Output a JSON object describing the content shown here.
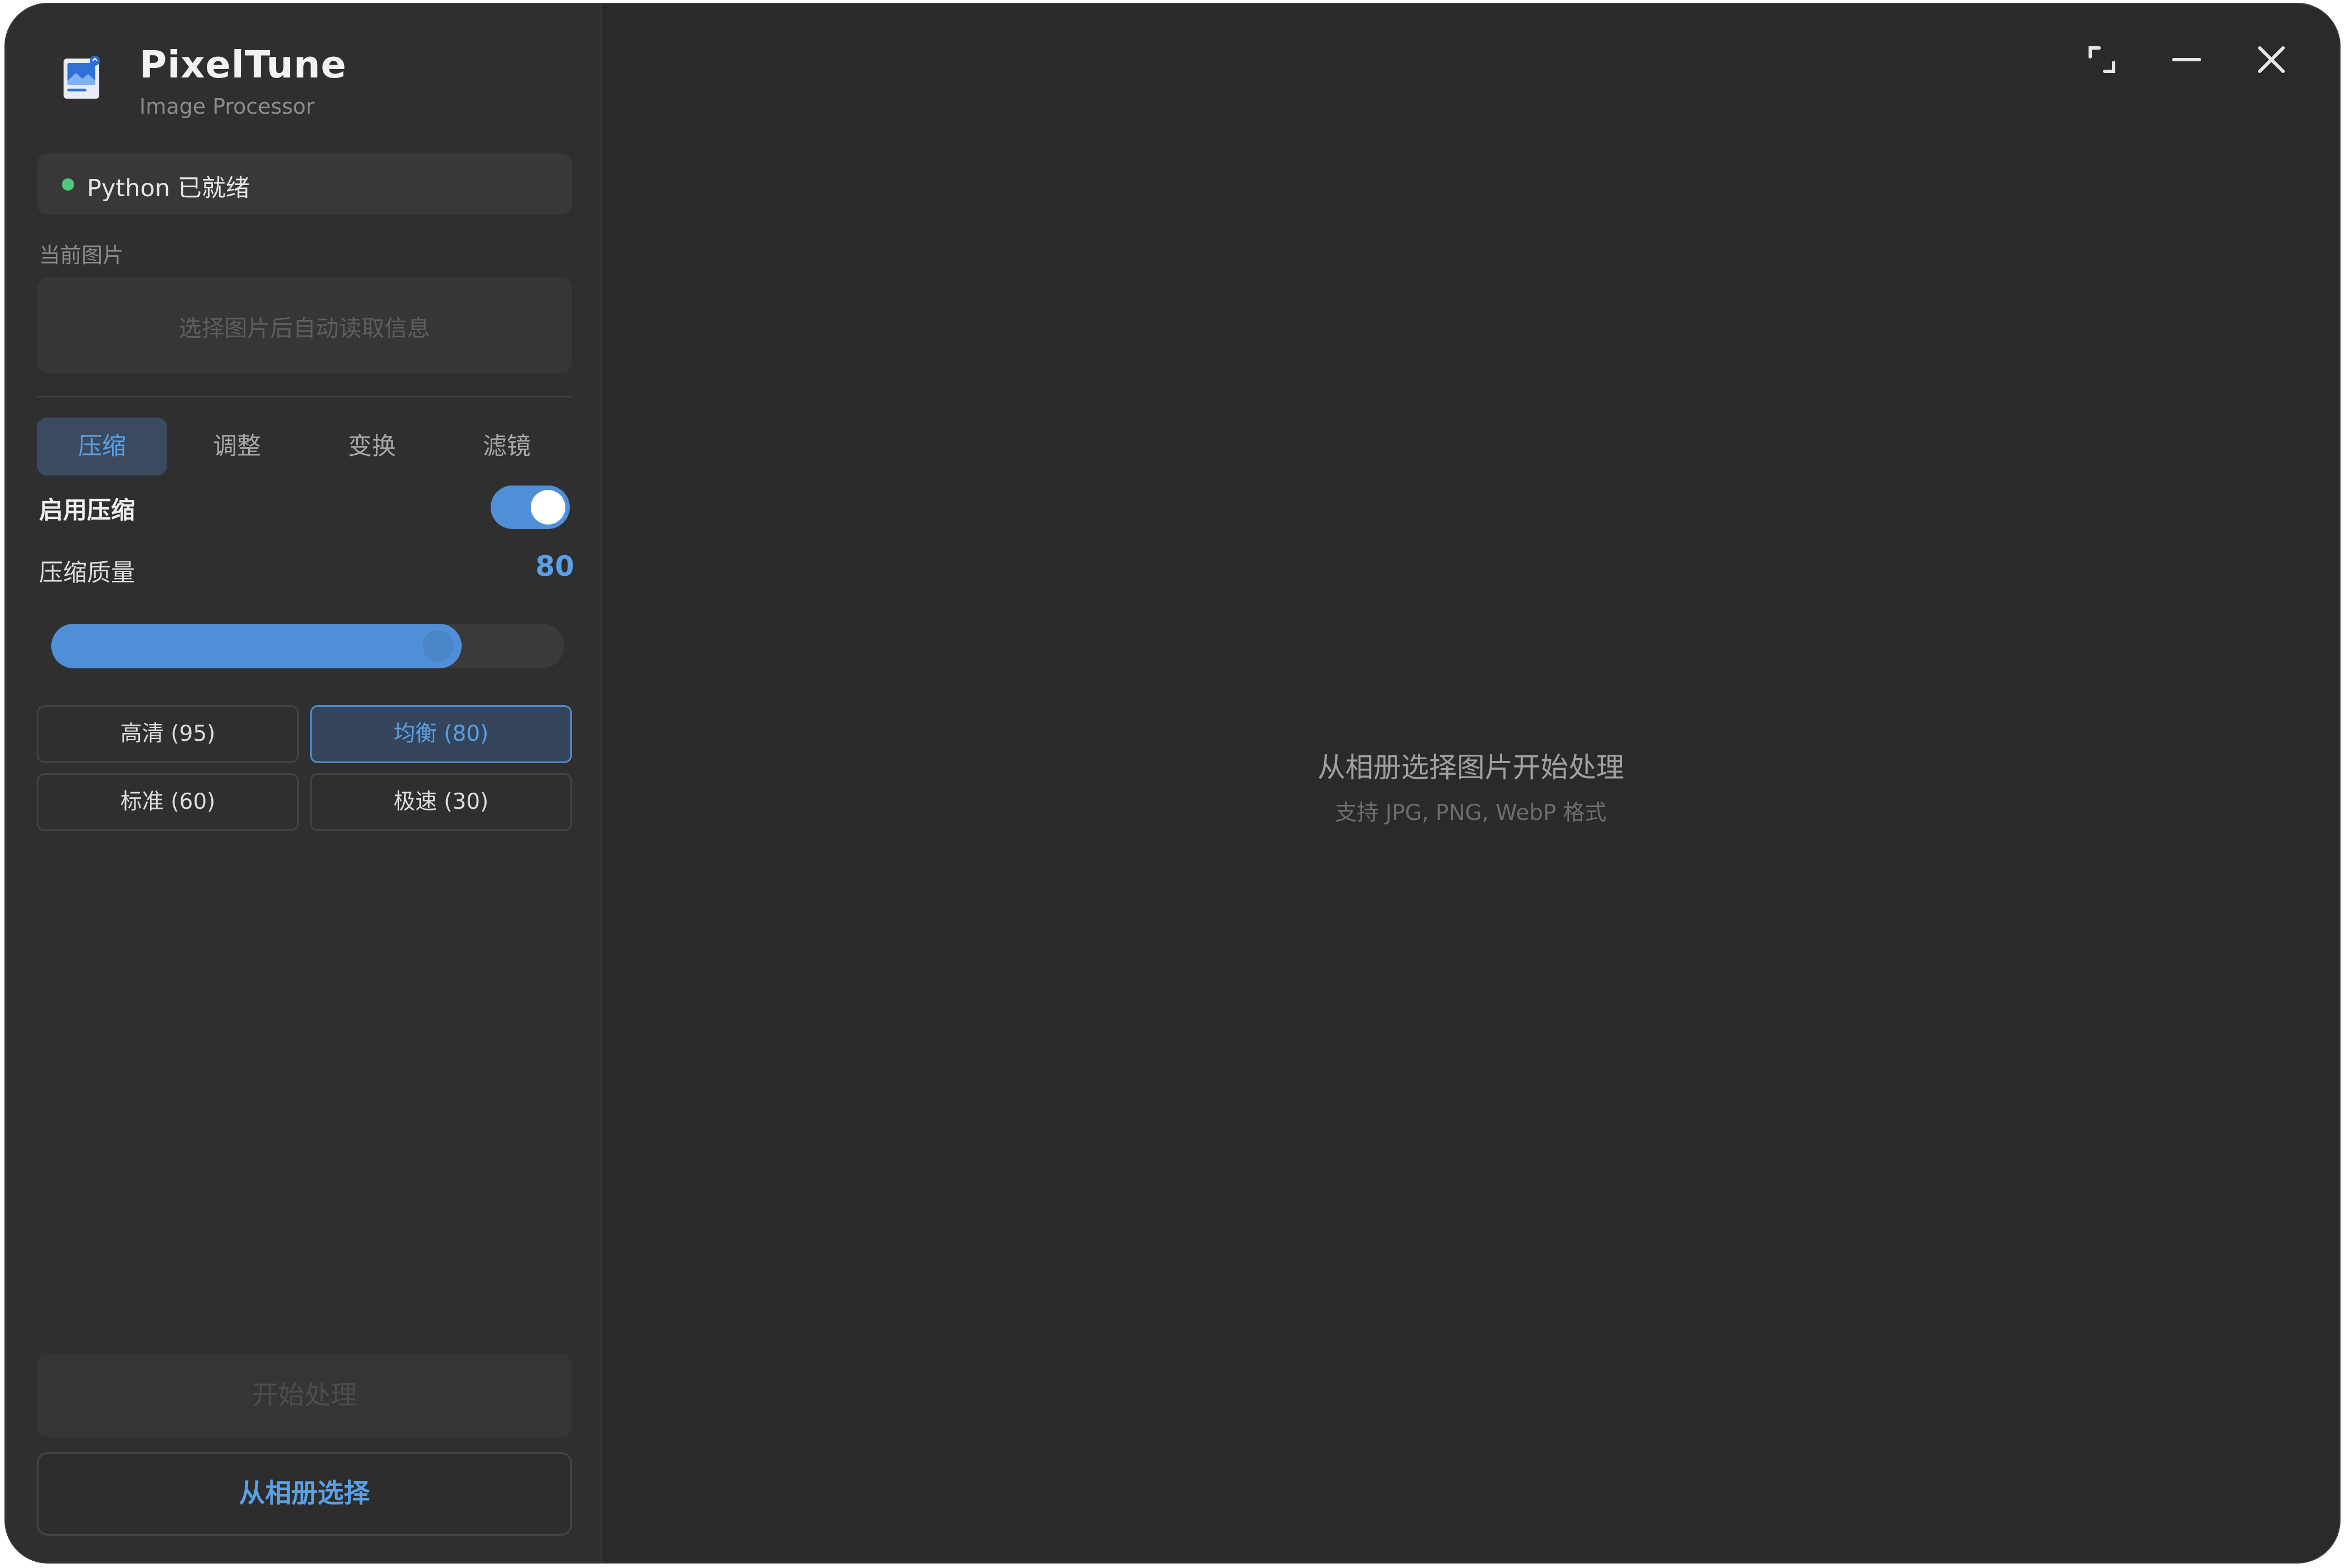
{
  "app": {
    "title": "PixelTune",
    "subtitle": "Image Processor"
  },
  "status": {
    "text": "Python 已就绪",
    "color": "#4cc97a"
  },
  "current_image": {
    "label": "当前图片",
    "placeholder": "选择图片后自动读取信息"
  },
  "tabs": [
    {
      "label": "压缩",
      "active": true
    },
    {
      "label": "调整",
      "active": false
    },
    {
      "label": "变换",
      "active": false
    },
    {
      "label": "滤镜",
      "active": false
    }
  ],
  "compression": {
    "enable_label": "启用压缩",
    "enabled": true,
    "quality_label": "压缩质量",
    "quality_value": "80",
    "slider_fraction": 0.8,
    "presets": [
      {
        "label": "高清 (95)",
        "active": false
      },
      {
        "label": "均衡 (80)",
        "active": true
      },
      {
        "label": "标准 (60)",
        "active": false
      },
      {
        "label": "极速 (30)",
        "active": false
      }
    ]
  },
  "actions": {
    "start": "开始处理",
    "pick_album": "从相册选择"
  },
  "empty_state": {
    "title": "从相册选择图片开始处理",
    "subtitle": "支持 JPG, PNG, WebP 格式"
  },
  "window_controls": [
    "expand-icon",
    "minimize-icon",
    "close-icon"
  ],
  "colors": {
    "accent": "#5aa0e6",
    "accent_fill": "#4f8fd8",
    "background": "#2a2a2a",
    "sidebar": "#2f2f2f"
  }
}
